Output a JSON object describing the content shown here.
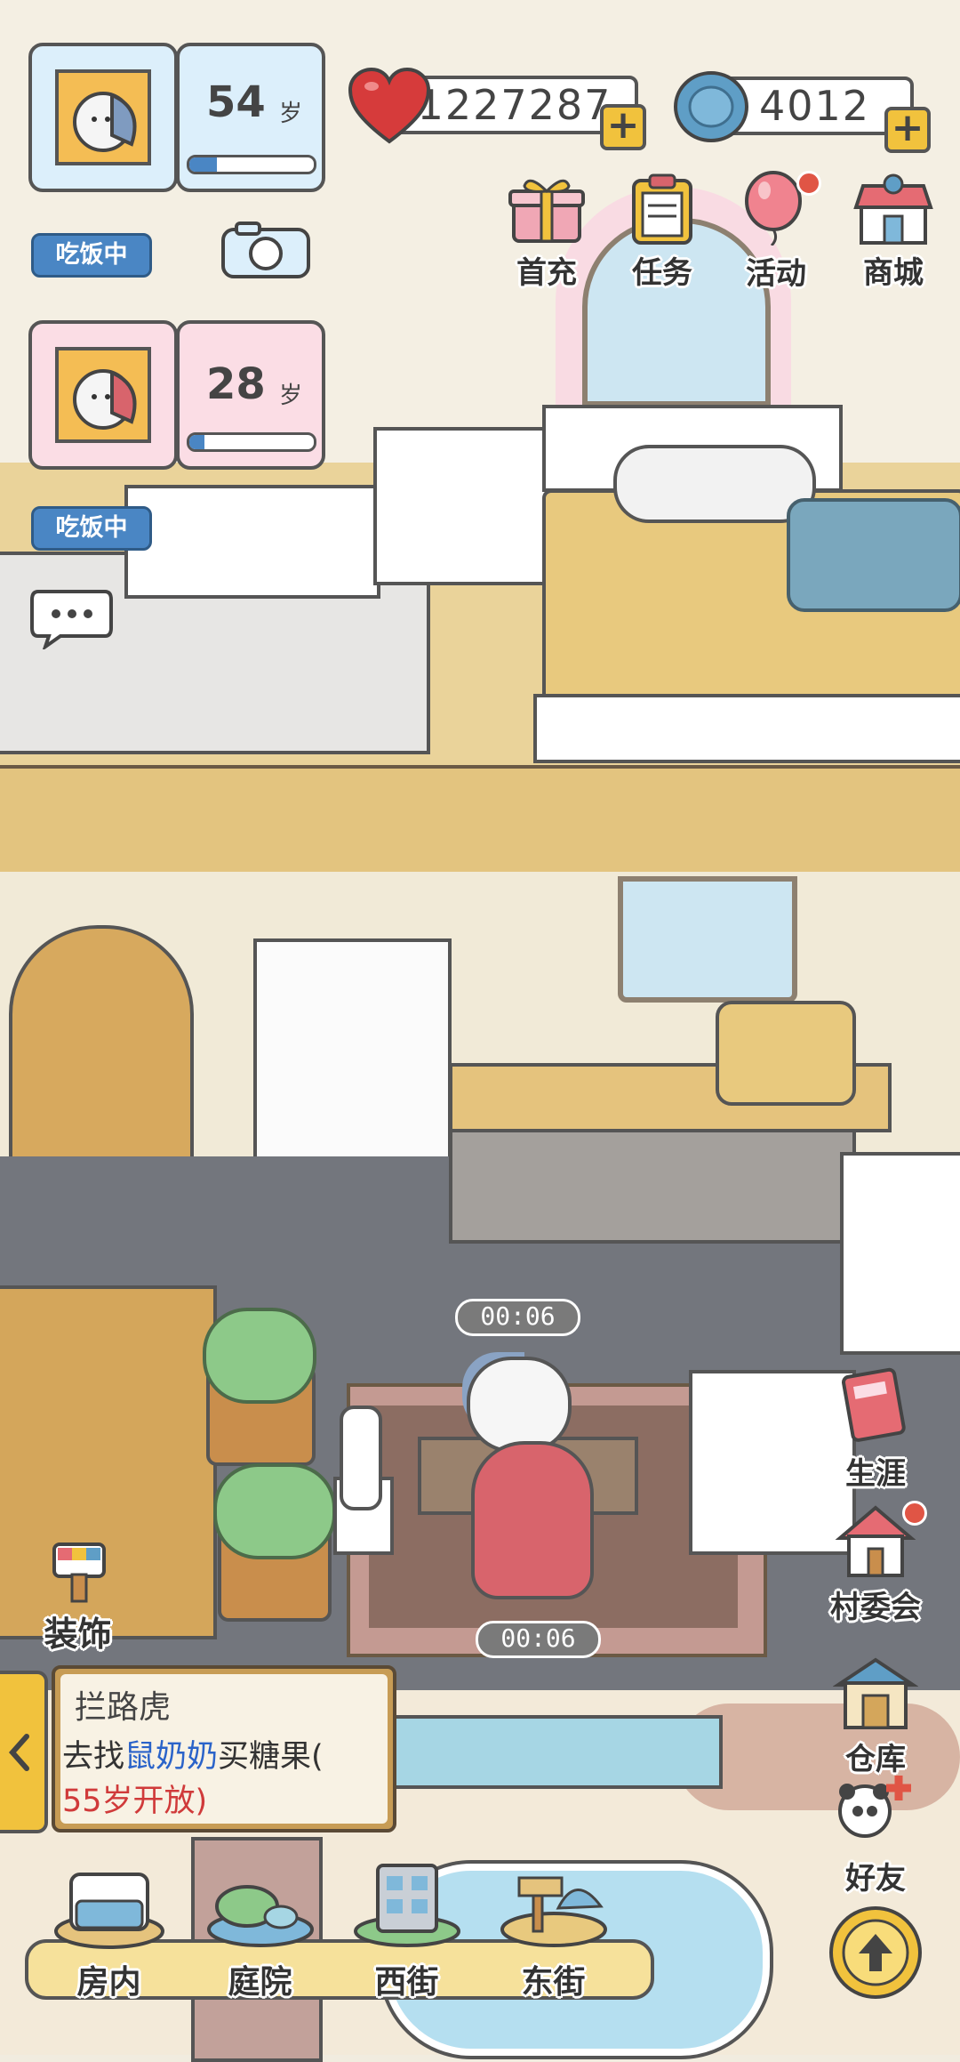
{
  "pets": [
    {
      "age": "54",
      "age_unit": "岁",
      "status": "吃饭中",
      "age_progress": 0.22
    },
    {
      "age": "28",
      "age_unit": "岁",
      "status": "吃饭中",
      "age_progress": 0.12
    }
  ],
  "resources": {
    "hearts": "1227287",
    "coins": "4012"
  },
  "top_menu": [
    {
      "label": "首充",
      "icon": "gift-icon"
    },
    {
      "label": "任务",
      "icon": "clipboard-icon"
    },
    {
      "label": "活动",
      "icon": "balloon-icon"
    },
    {
      "label": "商城",
      "icon": "shop-icon"
    }
  ],
  "timers": [
    "00:06",
    "00:06"
  ],
  "decorate": {
    "label": "装饰",
    "icon": "paint-palette-icon"
  },
  "quest": {
    "title": "拦路虎",
    "desc_before": "去找",
    "desc_highlight": "鼠奶奶",
    "desc_after": "买糖果(",
    "desc_unlock": "55岁开放)"
  },
  "side_menu": [
    {
      "label": "生涯",
      "icon": "diary-book-icon"
    },
    {
      "label": "村委会",
      "icon": "village-house-icon"
    },
    {
      "label": "仓库",
      "icon": "warehouse-icon"
    },
    {
      "label": "好友",
      "icon": "friends-panda-icon"
    }
  ],
  "bottom_nav": [
    {
      "label": "房内",
      "icon": "bed-icon"
    },
    {
      "label": "庭院",
      "icon": "garden-icon"
    },
    {
      "label": "西街",
      "icon": "west-street-building-icon"
    },
    {
      "label": "东街",
      "icon": "east-street-sign-icon"
    }
  ],
  "colors": {
    "accent_blue": "#4a86c4",
    "heart_red": "#d63b3b",
    "coin_blue": "#5f9ec6",
    "quest_highlight": "#2a63c9",
    "quest_unlock": "#d03a3a"
  }
}
